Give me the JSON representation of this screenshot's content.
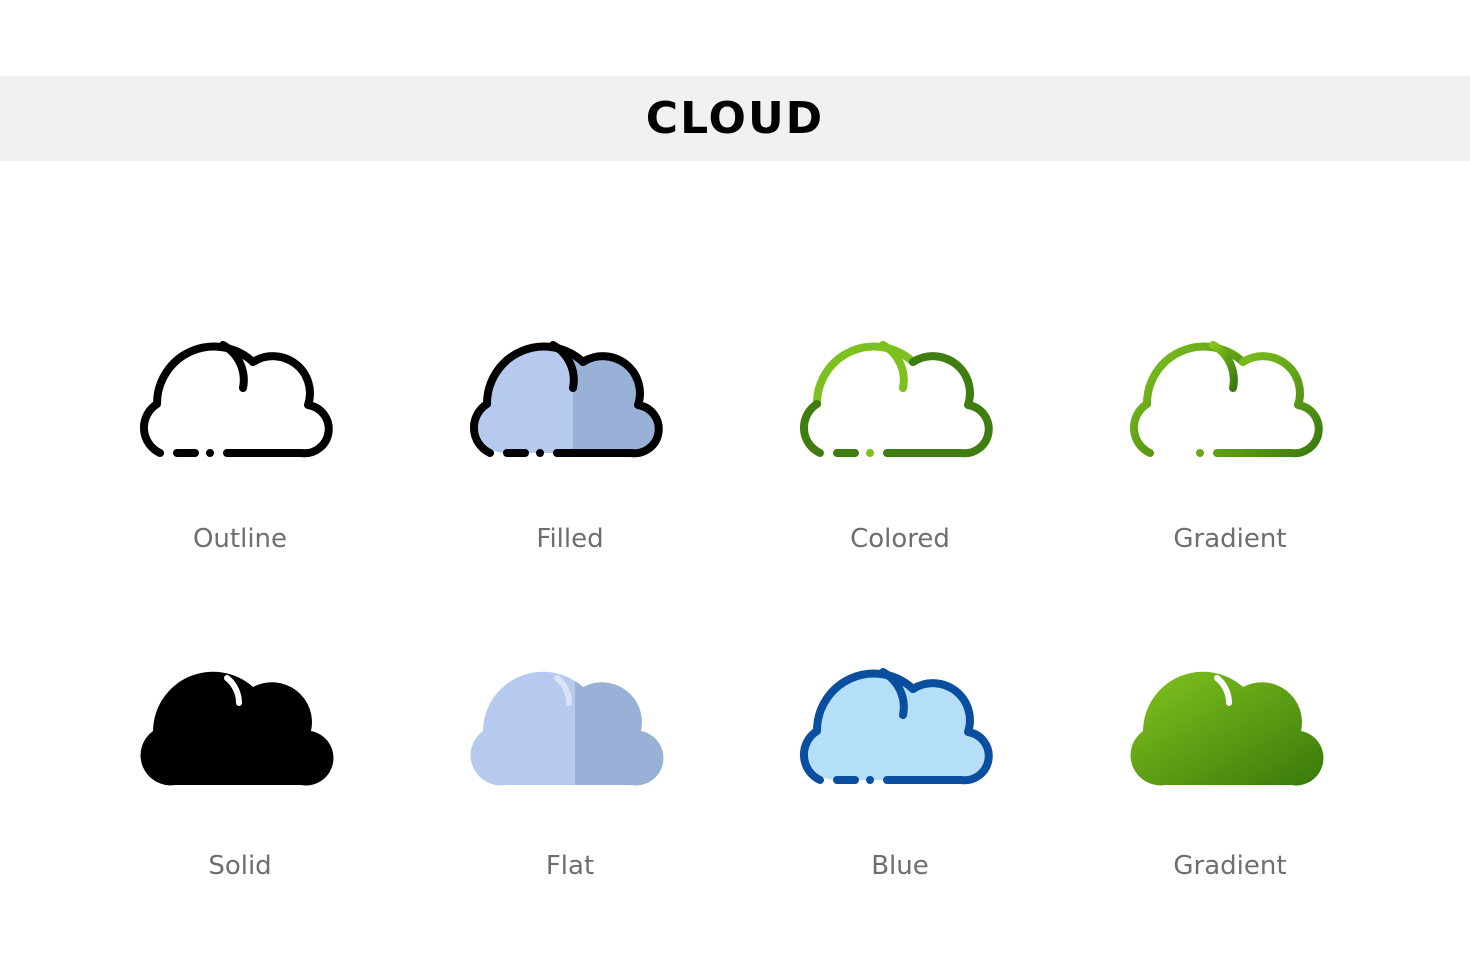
{
  "header": {
    "title": "CLOUD"
  },
  "colors": {
    "outline": "#000000",
    "filled_light": "#b6c9ef",
    "filled_dark": "#99b1d7",
    "green_light": "#7cc11e",
    "green_dark": "#3f7d10",
    "blue_stroke": "#0a4ea0",
    "blue_fill": "#b5dff7",
    "label_gray": "#6e6e6e"
  },
  "icons": [
    {
      "label": "Outline",
      "style": "outline"
    },
    {
      "label": "Filled",
      "style": "filled"
    },
    {
      "label": "Colored",
      "style": "colored"
    },
    {
      "label": "Gradient",
      "style": "gradient-outline"
    },
    {
      "label": "Solid",
      "style": "solid"
    },
    {
      "label": "Flat",
      "style": "flat"
    },
    {
      "label": "Blue",
      "style": "blue"
    },
    {
      "label": "Gradient",
      "style": "gradient-solid"
    }
  ]
}
